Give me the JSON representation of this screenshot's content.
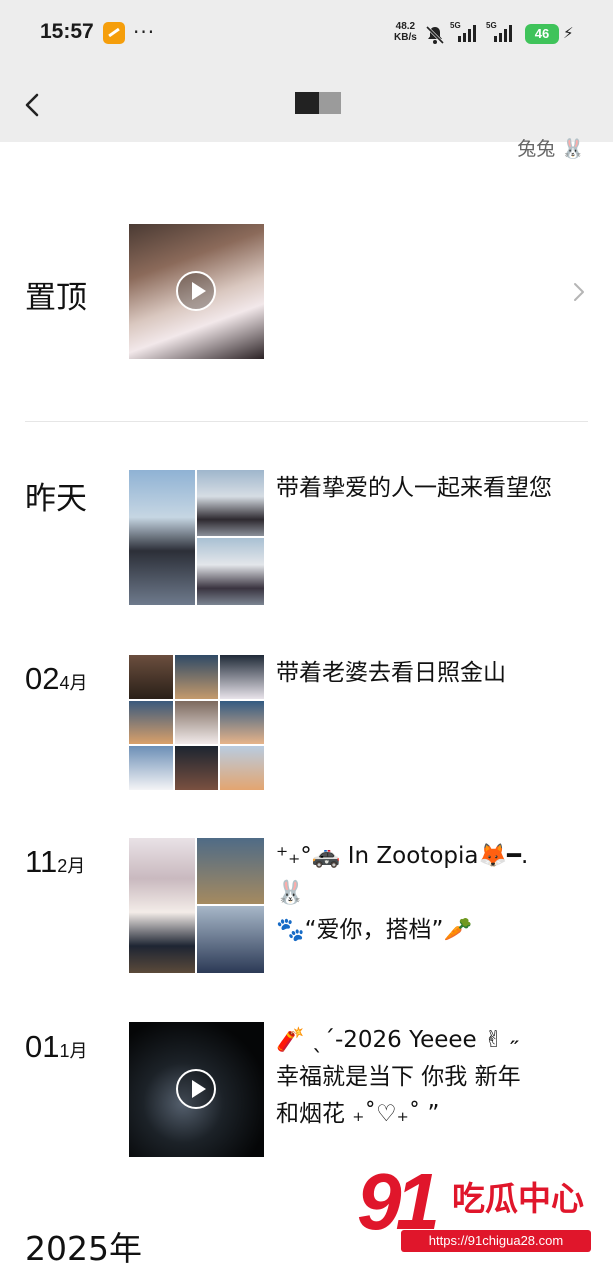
{
  "status_bar": {
    "time": "15:57",
    "dots": "···",
    "net_speed_value": "48.2",
    "net_speed_unit": "KB/s",
    "sim1_tag": "5G",
    "sim2_tag": "5G",
    "battery": "46",
    "bolt": "⚡"
  },
  "nav": {
    "back_icon": "chevron-left-icon"
  },
  "signature": "兔兔 🐰",
  "pinned": {
    "label": "置顶"
  },
  "posts": [
    {
      "date_label": "昨天",
      "text": "带着挚爱的人一起来看望您"
    },
    {
      "day": "02",
      "month": "4月",
      "text": "带着老婆去看日照金山"
    },
    {
      "day": "11",
      "month": "2月",
      "text_line1": "⁺₊°🚓 In Zootopia🦊━.",
      "text_line2": "🐰",
      "text_line3": "🐾“爱你，搭档”🥕"
    },
    {
      "day": "01",
      "month": "1月",
      "text_line1": "🧨 ˎˊ-2026 Yeeee ✌︎ ˶",
      "text_line2": "幸福就是当下  你我  新年",
      "text_line3": "和烟花 ₊˚♡₊˚ ”"
    }
  ],
  "year_label": "2025年",
  "watermark": {
    "number": "91",
    "name": "吃瓜中心",
    "url": "https://91chigua28.com"
  },
  "colors": {
    "bar_bg": "#ededed",
    "battery": "#3fc35a",
    "watermark_red": "#e0162b"
  }
}
